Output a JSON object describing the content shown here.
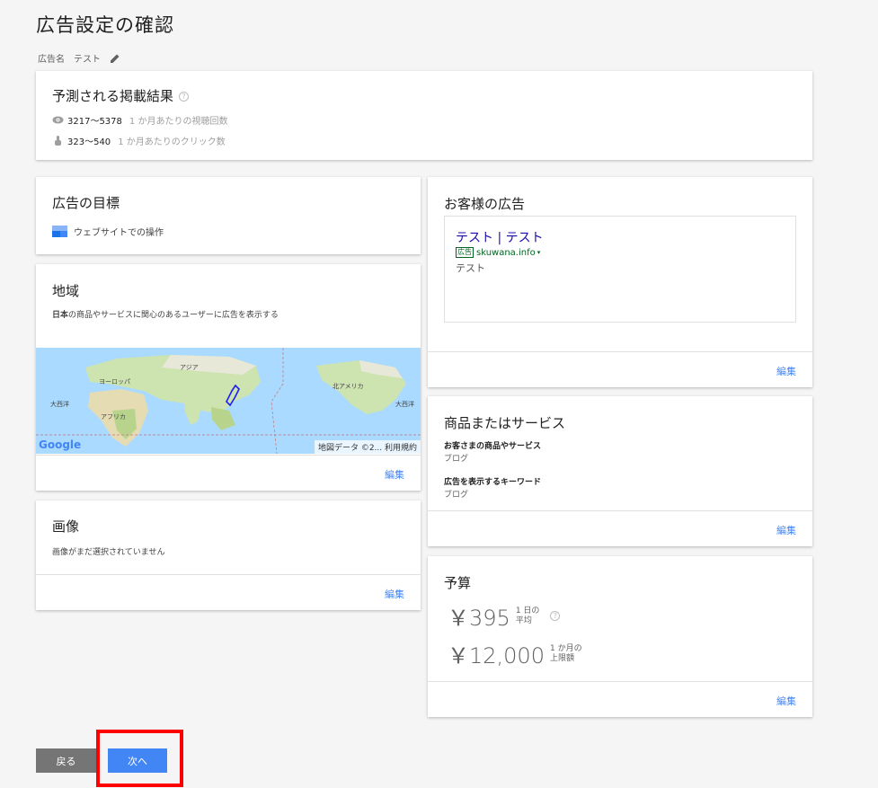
{
  "page": {
    "title": "広告設定の確認",
    "ad_name_label": "広告名",
    "ad_name_value": "テスト"
  },
  "forecast": {
    "title": "予測される掲載結果",
    "views_value": "3217〜5378",
    "views_label": "1 か月あたりの視聴回数",
    "clicks_value": "323〜540",
    "clicks_label": "1 か月あたりのクリック数"
  },
  "goal": {
    "title": "広告の目標",
    "value": "ウェブサイトでの操作"
  },
  "region": {
    "title": "地域",
    "desc_bold": "日本",
    "desc_rest": "の商品やサービスに関心のあるユーザーに広告を表示する",
    "map_labels": {
      "asia": "アジア",
      "europe": "ヨーロッパ",
      "africa": "アフリカ",
      "north_america": "北アメリカ",
      "ocean_left": "大西洋",
      "ocean_right": "大西洋"
    },
    "map_attribution": "地図データ ©2... 利用規約",
    "google_logo": "Google",
    "edit": "編集"
  },
  "image": {
    "title": "画像",
    "desc": "画像がまだ選択されていません",
    "edit": "編集"
  },
  "ad": {
    "title": "お客様の広告",
    "headline": "テスト | テスト",
    "badge": "広告",
    "url": "skuwana.info",
    "description": "テスト",
    "edit": "編集"
  },
  "service": {
    "title": "商品またはサービス",
    "product_label": "お客さまの商品やサービス",
    "product_value": "ブログ",
    "keyword_label": "広告を表示するキーワード",
    "keyword_value": "ブログ",
    "edit": "編集"
  },
  "budget": {
    "title": "予算",
    "daily_value": "￥395",
    "daily_unit_1": "1 日の",
    "daily_unit_2": "平均",
    "monthly_value": "￥12,000",
    "monthly_unit_1": "1 か月の",
    "monthly_unit_2": "上限額",
    "edit": "編集"
  },
  "buttons": {
    "back": "戻る",
    "next": "次へ"
  },
  "colors": {
    "accent": "#4285f4",
    "highlight": "#ff0000"
  }
}
